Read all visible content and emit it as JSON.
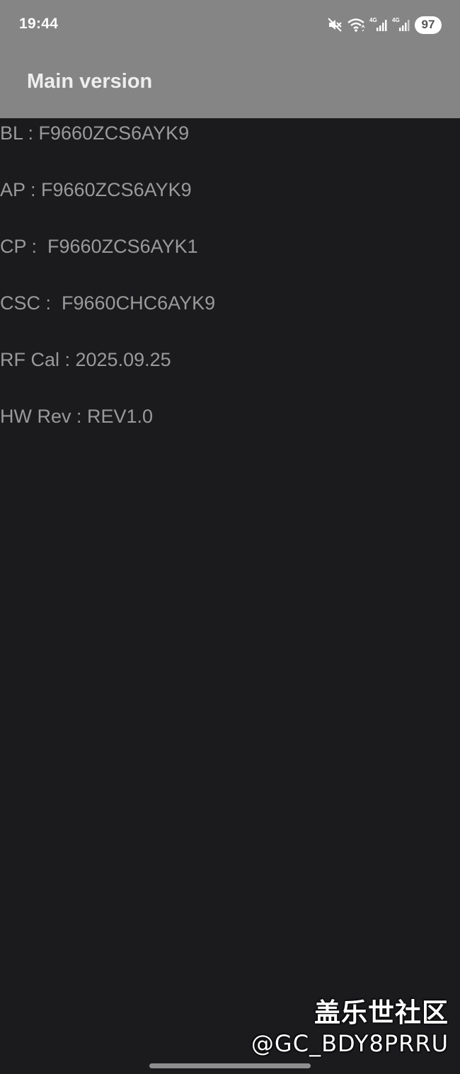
{
  "status_bar": {
    "time": "19:44",
    "battery": "97",
    "network_1": "4G",
    "network_2": "4G",
    "icons": [
      "mute-icon",
      "wifi-icon",
      "signal-icon",
      "signal-icon",
      "battery-icon"
    ]
  },
  "app_bar": {
    "title": "Main version"
  },
  "version_info": [
    {
      "text": "BL : F9660ZCS6AYK9"
    },
    {
      "text": "AP : F9660ZCS6AYK9"
    },
    {
      "text": "CP :  F9660ZCS6AYK1"
    },
    {
      "text": "CSC :  F9660CHC6AYK9"
    },
    {
      "text": "RF Cal : 2025.09.25"
    },
    {
      "text": "HW Rev : REV1.0"
    }
  ],
  "watermark": {
    "site": "盖乐世社区",
    "user": "@GC_BDY8PRRU"
  },
  "colors": {
    "app_bar_bg": "#858585",
    "content_bg": "#1b1b1e",
    "info_text": "#9a9a9c"
  }
}
